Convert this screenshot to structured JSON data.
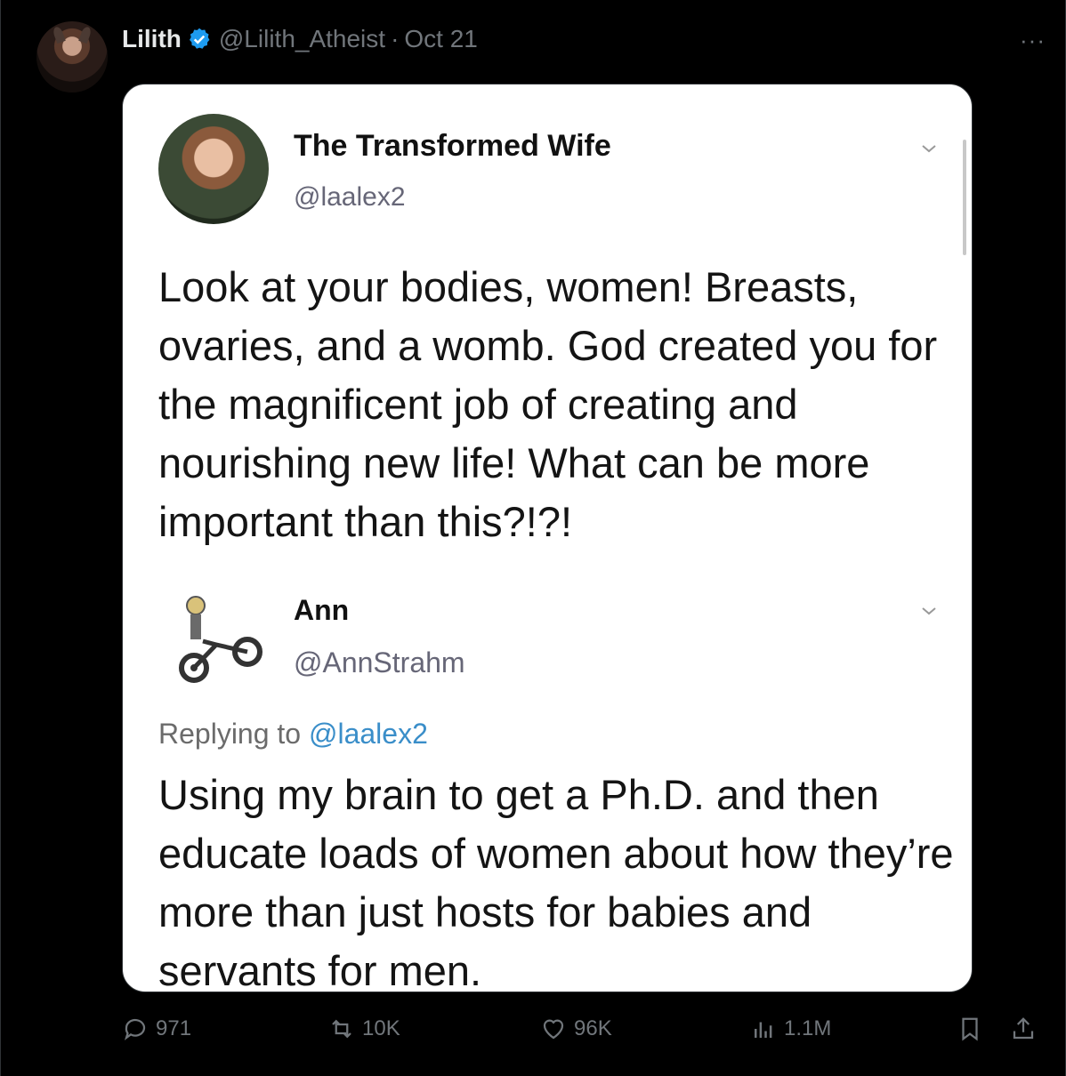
{
  "author": {
    "name": "Lilith",
    "handle": "@Lilith_Atheist",
    "separator": "·",
    "date": "Oct 21",
    "more": "···"
  },
  "embedded": {
    "first": {
      "name": "The Transformed Wife",
      "handle": "@laalex2",
      "text": "Look at your bodies, women! Breasts, ovaries, and a womb. God created you for the magnificent job of creating and nourishing new life! What can be more important than this?!?!"
    },
    "reply": {
      "name": "Ann",
      "handle": "@AnnStrahm",
      "replying_prefix": "Replying to",
      "replying_to": "@laalex2",
      "text": "Using my brain to get a Ph.D. and then educate loads of women about how they’re more than just hosts for babies and servants for men."
    }
  },
  "actions": {
    "replies": "971",
    "reposts": "10K",
    "likes": "96K",
    "views": "1.1M"
  },
  "icons": [
    "verified-icon",
    "more-icon",
    "chevron-down-icon",
    "reply-icon",
    "repost-icon",
    "like-icon",
    "views-icon",
    "bookmark-icon",
    "share-icon"
  ],
  "colors": {
    "verified": "#1d9bf0",
    "muted": "#71767b",
    "link": "#3a8ec9"
  }
}
